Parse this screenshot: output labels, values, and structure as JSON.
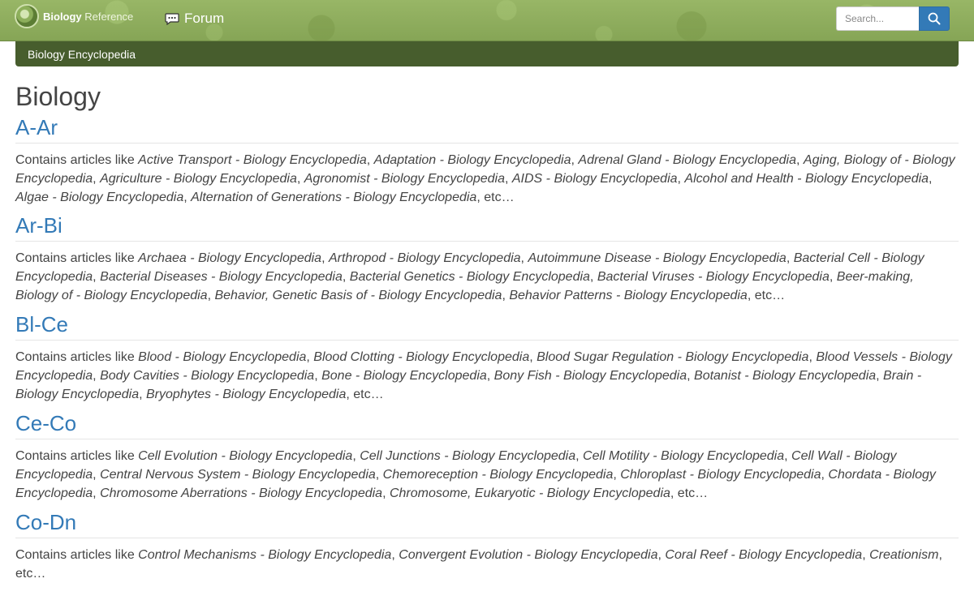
{
  "header": {
    "brand_bold": "Biology",
    "brand_light": "Reference",
    "forum_label": "Forum",
    "search_placeholder": "Search..."
  },
  "breadcrumb": "Biology Encyclopedia",
  "page_title": "Biology",
  "contains_prefix": "Contains articles like",
  "etc": ", etc…",
  "sections": [
    {
      "title": "A-Ar",
      "articles": [
        "Active Transport - Biology Encyclopedia",
        "Adaptation - Biology Encyclopedia",
        "Adrenal Gland - Biology Encyclopedia",
        "Aging, Biology of - Biology Encyclopedia",
        "Agriculture - Biology Encyclopedia",
        "Agronomist - Biology Encyclopedia",
        "AIDS - Biology Encyclopedia",
        "Alcohol and Health - Biology Encyclopedia",
        "Algae - Biology Encyclopedia",
        "Alternation of Generations - Biology Encyclopedia"
      ]
    },
    {
      "title": "Ar-Bi",
      "articles": [
        "Archaea - Biology Encyclopedia",
        "Arthropod - Biology Encyclopedia",
        "Autoimmune Disease - Biology Encyclopedia",
        "Bacterial Cell - Biology Encyclopedia",
        "Bacterial Diseases - Biology Encyclopedia",
        "Bacterial Genetics - Biology Encyclopedia",
        "Bacterial Viruses - Biology Encyclopedia",
        "Beer-making, Biology of - Biology Encyclopedia",
        "Behavior, Genetic Basis of - Biology Encyclopedia",
        "Behavior Patterns - Biology Encyclopedia"
      ]
    },
    {
      "title": "Bl-Ce",
      "articles": [
        "Blood - Biology Encyclopedia",
        "Blood Clotting - Biology Encyclopedia",
        "Blood Sugar Regulation - Biology Encyclopedia",
        "Blood Vessels - Biology Encyclopedia",
        "Body Cavities - Biology Encyclopedia",
        "Bone - Biology Encyclopedia",
        "Bony Fish - Biology Encyclopedia",
        "Botanist - Biology Encyclopedia",
        "Brain - Biology Encyclopedia",
        "Bryophytes - Biology Encyclopedia"
      ]
    },
    {
      "title": "Ce-Co",
      "articles": [
        "Cell Evolution - Biology Encyclopedia",
        "Cell Junctions - Biology Encyclopedia",
        "Cell Motility - Biology Encyclopedia",
        "Cell Wall - Biology Encyclopedia",
        "Central Nervous System - Biology Encyclopedia",
        "Chemoreception - Biology Encyclopedia",
        "Chloroplast - Biology Encyclopedia",
        "Chordata - Biology Encyclopedia",
        "Chromosome Aberrations - Biology Encyclopedia",
        "Chromosome, Eukaryotic - Biology Encyclopedia"
      ]
    },
    {
      "title": "Co-Dn",
      "articles": [
        "Control Mechanisms - Biology Encyclopedia",
        "Convergent Evolution - Biology Encyclopedia",
        "Coral Reef - Biology Encyclopedia",
        "Creationism"
      ]
    }
  ]
}
